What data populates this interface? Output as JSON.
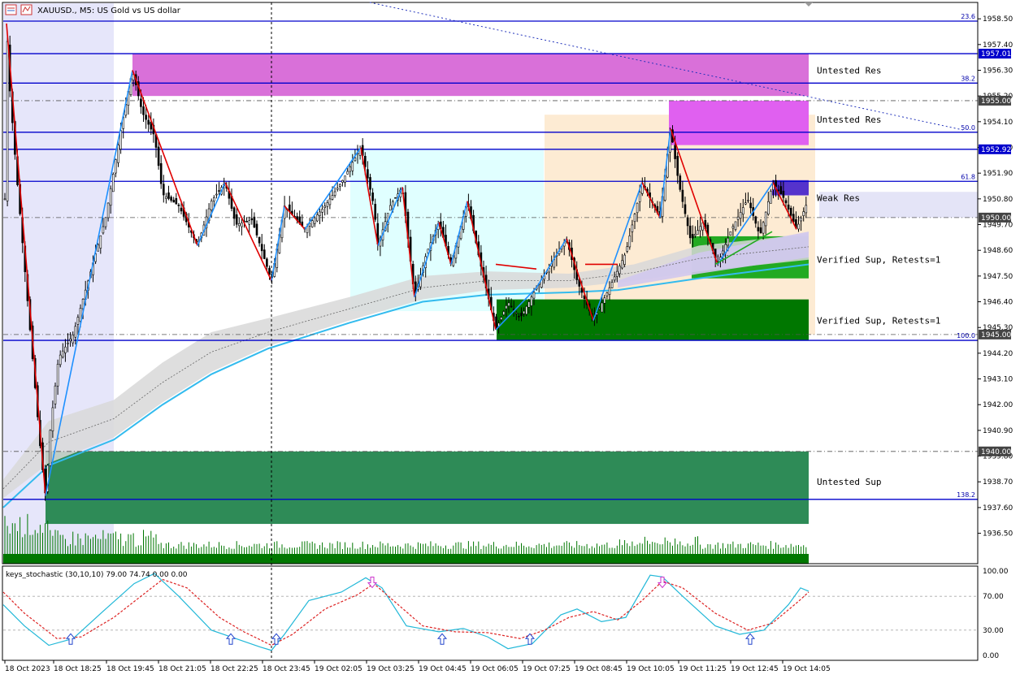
{
  "window": {
    "symbol_title": "XAUUSD., M5: US Gold vs US dollar",
    "icons": [
      "chart-window-icon",
      "symbol-icon"
    ]
  },
  "colors": {
    "level_line": "#0000cc",
    "resistance_magenta": "#d970d9",
    "resistance_magenta_bright": "#e060f0",
    "weak_res_purple": "#5533cc",
    "support_green": "#2e8b57",
    "support_green_bright": "#22aa22",
    "support_green_dark": "#007700",
    "zigzag_down": "#e00000",
    "zigzag_up": "#1e90ff",
    "ma_line": "#33bbee",
    "cloud_gray": "#d8d8d8",
    "session_blue": "#e6e6fa",
    "session_cyan": "#e0ffff",
    "session_peach": "#fdebd3",
    "volume_green": "#007700",
    "price_label_bg": "#0000cc",
    "stoch_main": "#22b8d8",
    "stoch_signal": "#dd2222"
  },
  "main_chart": {
    "price_min": 1935.2,
    "price_max": 1959.2,
    "price_ticks": [
      "1958.50",
      "1957.40",
      "1956.30",
      "1955.20",
      "1954.10",
      "1953.00",
      "1951.90",
      "1950.80",
      "1949.70",
      "1948.60",
      "1947.50",
      "1946.40",
      "1945.30",
      "1944.20",
      "1943.10",
      "1942.00",
      "1940.90",
      "1939.80",
      "1938.70",
      "1937.60",
      "1936.50"
    ],
    "highlighted_prices": [
      {
        "label": "1957.01",
        "price": 1957.01
      },
      {
        "label": "1955.00",
        "price": 1955.0
      },
      {
        "label": "1952.92",
        "price": 1952.92
      },
      {
        "label": "1950.00",
        "price": 1950.0
      },
      {
        "label": "1945.00",
        "price": 1945.0
      },
      {
        "label": "1940.00",
        "price": 1940.0
      }
    ],
    "fib_levels": [
      {
        "label": "23.6",
        "price": 1958.4
      },
      {
        "label": "38.2",
        "price": 1955.75
      },
      {
        "label": "50.0",
        "price": 1953.65
      },
      {
        "label": "61.8",
        "price": 1951.55
      },
      {
        "label": "100.0",
        "price": 1944.75
      },
      {
        "label": "138.2",
        "price": 1937.95
      }
    ],
    "zone_labels": [
      {
        "text": "Untested Res",
        "price": 1956.3
      },
      {
        "text": "Untested Res",
        "price": 1954.2
      },
      {
        "text": "Weak Res",
        "price": 1950.85
      },
      {
        "text": "Verified Sup, Retests=1",
        "price": 1948.2
      },
      {
        "text": "Verified Sup, Retests=1",
        "price": 1945.6
      },
      {
        "text": "Untested Sup",
        "price": 1938.7
      }
    ],
    "time_ticks": [
      "18 Oct 2023",
      "18 Oct 18:25",
      "18 Oct 19:45",
      "18 Oct 21:05",
      "18 Oct 22:25",
      "18 Oct 23:45",
      "19 Oct 02:05",
      "19 Oct 03:25",
      "19 Oct 04:45",
      "19 Oct 06:05",
      "19 Oct 07:25",
      "19 Oct 08:45",
      "19 Oct 10:05",
      "19 Oct 11:25",
      "19 Oct 12:45",
      "19 Oct 14:05"
    ]
  },
  "stochastic": {
    "title": "keys_stochastic (30,10,10) 79.00 74.74 0.00 0.00",
    "ticks": [
      "100.00",
      "70.00",
      "30.00",
      "0.00"
    ]
  }
}
